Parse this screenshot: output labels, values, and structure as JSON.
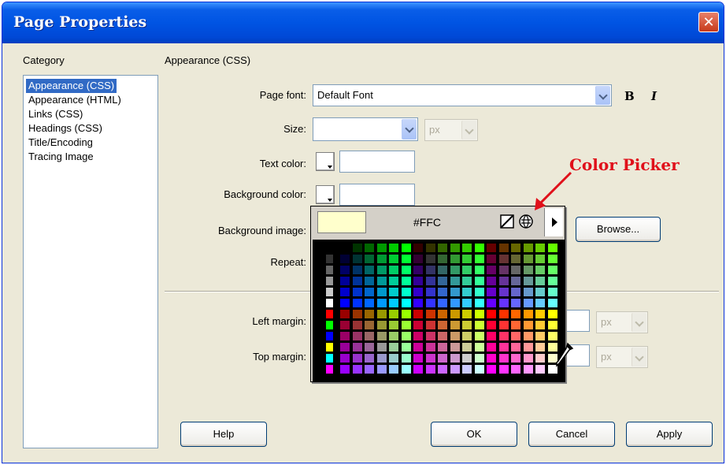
{
  "window": {
    "title": "Page Properties",
    "close_glyph": "✕"
  },
  "category": {
    "label": "Category",
    "items": [
      {
        "label": "Appearance (CSS)",
        "selected": true
      },
      {
        "label": "Appearance (HTML)",
        "selected": false
      },
      {
        "label": "Links (CSS)",
        "selected": false
      },
      {
        "label": "Headings (CSS)",
        "selected": false
      },
      {
        "label": "Title/Encoding",
        "selected": false
      },
      {
        "label": "Tracing Image",
        "selected": false
      }
    ]
  },
  "section_title": "Appearance (CSS)",
  "fields": {
    "page_font": {
      "label": "Page font:",
      "value": "Default Font"
    },
    "bold_label": "B",
    "italic_label": "I",
    "size": {
      "label": "Size:",
      "value": "",
      "unit": "px"
    },
    "text_color": {
      "label": "Text color:",
      "value": ""
    },
    "background_color": {
      "label": "Background color:",
      "value": ""
    },
    "background_image": {
      "label": "Background image:",
      "value": ""
    },
    "repeat": {
      "label": "Repeat:",
      "value": ""
    },
    "left_margin": {
      "label": "Left margin:",
      "value": "",
      "unit": "px"
    },
    "top_margin": {
      "label": "Top margin:",
      "value": "",
      "unit": "px"
    }
  },
  "buttons": {
    "browse": "Browse...",
    "help": "Help",
    "ok": "OK",
    "cancel": "Cancel",
    "apply": "Apply"
  },
  "color_picker": {
    "hex_value": "#FFC",
    "preview_color": "#ffffcc",
    "icons": [
      "no-color-icon",
      "system-color-icon",
      "menu-arrow-icon",
      "eyedropper-icon"
    ]
  },
  "annotation": {
    "text": "Color Picker",
    "color": "#e0101a"
  }
}
